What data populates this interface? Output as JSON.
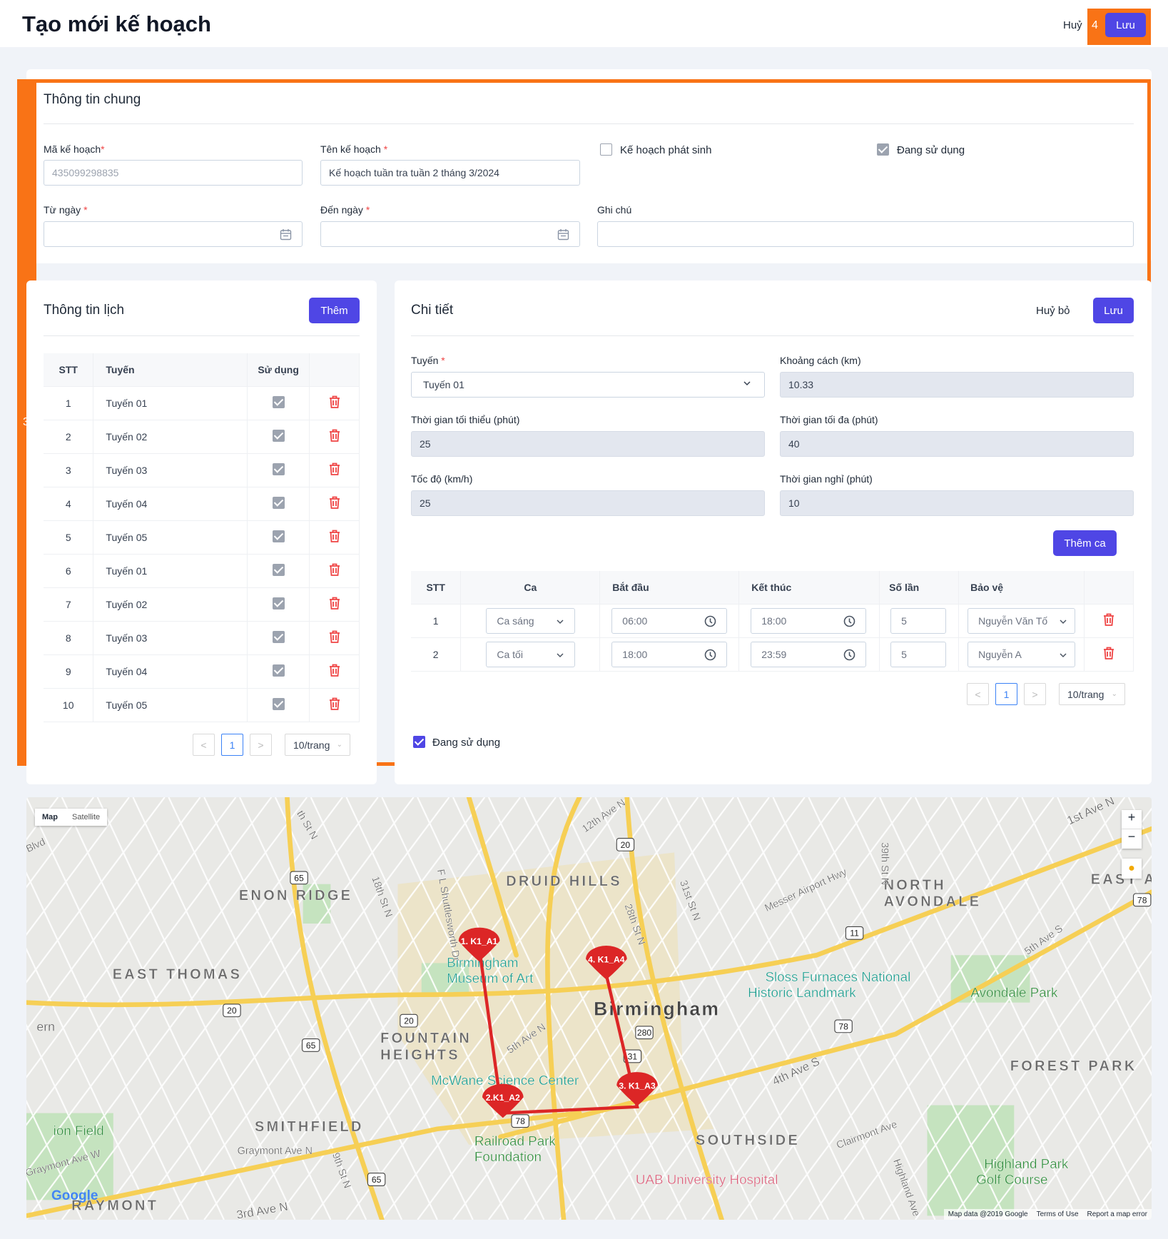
{
  "header": {
    "title": "Tạo mới kế hoạch",
    "cancel": "Huỷ",
    "save": "Lưu",
    "annotation": "4"
  },
  "general": {
    "annotation": "3",
    "title": "Thông tin chung",
    "code_label": "Mã kế hoạch",
    "code_placeholder": "435099298835",
    "name_label": "Tên kế hoạch",
    "name_value": "Kế hoạch tuần tra tuần 2 tháng 3/2024",
    "incidental_label": "Kế hoạch phát sinh",
    "incidental_checked": false,
    "active_label": "Đang sử dụng",
    "active_checked": true,
    "from_label": "Từ ngày",
    "to_label": "Đến ngày",
    "note_label": "Ghi chú",
    "required": "*"
  },
  "schedule": {
    "title": "Thông tin lịch",
    "add": "Thêm",
    "columns": [
      "STT",
      "Tuyến",
      "Sử dụng",
      ""
    ],
    "rows": [
      {
        "stt": "1",
        "route": "Tuyến 01",
        "used": true
      },
      {
        "stt": "2",
        "route": "Tuyến 02",
        "used": true
      },
      {
        "stt": "3",
        "route": "Tuyến 03",
        "used": true
      },
      {
        "stt": "4",
        "route": "Tuyến 04",
        "used": true
      },
      {
        "stt": "5",
        "route": "Tuyến 05",
        "used": true
      },
      {
        "stt": "6",
        "route": "Tuyến 01",
        "used": true
      },
      {
        "stt": "7",
        "route": "Tuyến 02",
        "used": true
      },
      {
        "stt": "8",
        "route": "Tuyến 03",
        "used": true
      },
      {
        "stt": "9",
        "route": "Tuyến 04",
        "used": true
      },
      {
        "stt": "10",
        "route": "Tuyến 05",
        "used": true
      }
    ],
    "pagination": {
      "prev": "<",
      "page": "1",
      "next": ">",
      "size": "10/trang"
    }
  },
  "detail": {
    "title": "Chi tiết",
    "cancel": "Huỷ bỏ",
    "save": "Lưu",
    "route_label": "Tuyến",
    "route_value": "Tuyến 01",
    "distance_label": "Khoảng cách (km)",
    "distance_value": "10.33",
    "min_time_label": "Thời gian tối thiểu (phút)",
    "min_time_value": "25",
    "max_time_label": "Thời gian tối đa (phút)",
    "max_time_value": "40",
    "speed_label": "Tốc độ (km/h)",
    "speed_value": "25",
    "rest_label": "Thời gian nghỉ (phút)",
    "rest_value": "10",
    "add_shift": "Thêm ca",
    "columns": [
      "STT",
      "Ca",
      "Bắt đầu",
      "Kết thúc",
      "Số lần",
      "Bảo vệ",
      ""
    ],
    "rows": [
      {
        "stt": "1",
        "shift": "Ca sáng",
        "start": "06:00",
        "end": "18:00",
        "count": "5",
        "guard": "Nguyễn Văn Tố"
      },
      {
        "stt": "2",
        "shift": "Ca tối",
        "start": "18:00",
        "end": "23:59",
        "count": "5",
        "guard": "Nguyễn A"
      }
    ],
    "pagination": {
      "prev": "<",
      "page": "1",
      "next": ">",
      "size": "10/trang"
    },
    "active_label": "Đang sử dụng",
    "active_checked": true
  },
  "map": {
    "type_map": "Map",
    "type_satellite": "Satellite",
    "zoom_in": "+",
    "zoom_out": "−",
    "logo": "Google",
    "attribution": "Map data @2019 Google",
    "terms": "Terms of Use",
    "report": "Report a map error",
    "route_color": "#dc2626",
    "markers": [
      "1. K1_A1",
      "2.K1_A2",
      "3. K1_A3",
      "4. K1_A4"
    ],
    "areas": [
      "DRUID HILLS",
      "ENON RIDGE",
      "NORTH",
      "AVONDALE",
      "EAST AVONDAL",
      "EAST THOMAS",
      "FOUNTAIN",
      "HEIGHTS",
      "SMITHFIELD",
      "SOUTHSIDE",
      "FOREST PARK",
      "RAYMONT"
    ],
    "city": "Birmingham",
    "places": [
      "Birmingham",
      "Museum of Art",
      "Sloss Furnaces National",
      "Historic Landmark",
      "Avondale Park",
      "McWane Science Center",
      "Railroad Park",
      "Foundation",
      "UAB University Hospital",
      "Highland Park",
      "Golf Course",
      "ion Field",
      "ern"
    ],
    "streets": [
      "12th Ave N",
      "1st Ave N",
      "Messer Airport Hwy",
      "4th Ave S",
      "5th Ave S",
      "Clairmont Ave",
      "Highland Ave",
      "28th St N",
      "31st St N",
      "39th St N",
      "18th St N",
      "F L Shuttlesworth Dr",
      "9th St N",
      "5th Ave N",
      "3rd Ave N",
      "Graymont Ave N",
      "Graymont Ave W",
      "Blvd",
      "th St N"
    ],
    "shields": [
      "20",
      "65",
      "20",
      "20",
      "65",
      "280",
      "78",
      "11",
      "31",
      "78",
      "65",
      "78"
    ]
  }
}
